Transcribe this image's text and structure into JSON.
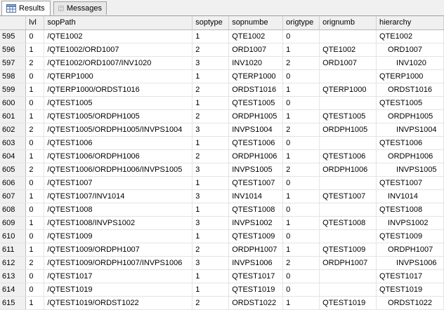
{
  "tabs": {
    "results_label": "Results",
    "messages_label": "Messages"
  },
  "columns": [
    "lvl",
    "sopPath",
    "soptype",
    "sopnumbe",
    "origtype",
    "orignumb",
    "hierarchy"
  ],
  "rows": [
    {
      "n": "595",
      "lvl": "0",
      "path": "/QTE1002",
      "soptype": "1",
      "sopnumbe": "QTE1002",
      "origtype": "0",
      "orignumb": "",
      "hierarchy": "QTE1002",
      "indent": 0
    },
    {
      "n": "596",
      "lvl": "1",
      "path": "/QTE1002/ORD1007",
      "soptype": "2",
      "sopnumbe": "ORD1007",
      "origtype": "1",
      "orignumb": "QTE1002",
      "hierarchy": "ORD1007",
      "indent": 1
    },
    {
      "n": "597",
      "lvl": "2",
      "path": "/QTE1002/ORD1007/INV1020",
      "soptype": "3",
      "sopnumbe": "INV1020",
      "origtype": "2",
      "orignumb": "ORD1007",
      "hierarchy": "INV1020",
      "indent": 2
    },
    {
      "n": "598",
      "lvl": "0",
      "path": "/QTERP1000",
      "soptype": "1",
      "sopnumbe": "QTERP1000",
      "origtype": "0",
      "orignumb": "",
      "hierarchy": "QTERP1000",
      "indent": 0
    },
    {
      "n": "599",
      "lvl": "1",
      "path": "/QTERP1000/ORDST1016",
      "soptype": "2",
      "sopnumbe": "ORDST1016",
      "origtype": "1",
      "orignumb": "QTERP1000",
      "hierarchy": "ORDST1016",
      "indent": 1
    },
    {
      "n": "600",
      "lvl": "0",
      "path": "/QTEST1005",
      "soptype": "1",
      "sopnumbe": "QTEST1005",
      "origtype": "0",
      "orignumb": "",
      "hierarchy": "QTEST1005",
      "indent": 0
    },
    {
      "n": "601",
      "lvl": "1",
      "path": "/QTEST1005/ORDPH1005",
      "soptype": "2",
      "sopnumbe": "ORDPH1005",
      "origtype": "1",
      "orignumb": "QTEST1005",
      "hierarchy": "ORDPH1005",
      "indent": 1
    },
    {
      "n": "602",
      "lvl": "2",
      "path": "/QTEST1005/ORDPH1005/INVPS1004",
      "soptype": "3",
      "sopnumbe": "INVPS1004",
      "origtype": "2",
      "orignumb": "ORDPH1005",
      "hierarchy": "INVPS1004",
      "indent": 2
    },
    {
      "n": "603",
      "lvl": "0",
      "path": "/QTEST1006",
      "soptype": "1",
      "sopnumbe": "QTEST1006",
      "origtype": "0",
      "orignumb": "",
      "hierarchy": "QTEST1006",
      "indent": 0
    },
    {
      "n": "604",
      "lvl": "1",
      "path": "/QTEST1006/ORDPH1006",
      "soptype": "2",
      "sopnumbe": "ORDPH1006",
      "origtype": "1",
      "orignumb": "QTEST1006",
      "hierarchy": "ORDPH1006",
      "indent": 1
    },
    {
      "n": "605",
      "lvl": "2",
      "path": "/QTEST1006/ORDPH1006/INVPS1005",
      "soptype": "3",
      "sopnumbe": "INVPS1005",
      "origtype": "2",
      "orignumb": "ORDPH1006",
      "hierarchy": "INVPS1005",
      "indent": 2
    },
    {
      "n": "606",
      "lvl": "0",
      "path": "/QTEST1007",
      "soptype": "1",
      "sopnumbe": "QTEST1007",
      "origtype": "0",
      "orignumb": "",
      "hierarchy": "QTEST1007",
      "indent": 0
    },
    {
      "n": "607",
      "lvl": "1",
      "path": "/QTEST1007/INV1014",
      "soptype": "3",
      "sopnumbe": "INV1014",
      "origtype": "1",
      "orignumb": "QTEST1007",
      "hierarchy": "INV1014",
      "indent": 1
    },
    {
      "n": "608",
      "lvl": "0",
      "path": "/QTEST1008",
      "soptype": "1",
      "sopnumbe": "QTEST1008",
      "origtype": "0",
      "orignumb": "",
      "hierarchy": "QTEST1008",
      "indent": 0
    },
    {
      "n": "609",
      "lvl": "1",
      "path": "/QTEST1008/INVPS1002",
      "soptype": "3",
      "sopnumbe": "INVPS1002",
      "origtype": "1",
      "orignumb": "QTEST1008",
      "hierarchy": "INVPS1002",
      "indent": 1
    },
    {
      "n": "610",
      "lvl": "0",
      "path": "/QTEST1009",
      "soptype": "1",
      "sopnumbe": "QTEST1009",
      "origtype": "0",
      "orignumb": "",
      "hierarchy": "QTEST1009",
      "indent": 0
    },
    {
      "n": "611",
      "lvl": "1",
      "path": "/QTEST1009/ORDPH1007",
      "soptype": "2",
      "sopnumbe": "ORDPH1007",
      "origtype": "1",
      "orignumb": "QTEST1009",
      "hierarchy": "ORDPH1007",
      "indent": 1
    },
    {
      "n": "612",
      "lvl": "2",
      "path": "/QTEST1009/ORDPH1007/INVPS1006",
      "soptype": "3",
      "sopnumbe": "INVPS1006",
      "origtype": "2",
      "orignumb": "ORDPH1007",
      "hierarchy": "INVPS1006",
      "indent": 2
    },
    {
      "n": "613",
      "lvl": "0",
      "path": "/QTEST1017",
      "soptype": "1",
      "sopnumbe": "QTEST1017",
      "origtype": "0",
      "orignumb": "",
      "hierarchy": "QTEST1017",
      "indent": 0
    },
    {
      "n": "614",
      "lvl": "0",
      "path": "/QTEST1019",
      "soptype": "1",
      "sopnumbe": "QTEST1019",
      "origtype": "0",
      "orignumb": "",
      "hierarchy": "QTEST1019",
      "indent": 0
    },
    {
      "n": "615",
      "lvl": "1",
      "path": "/QTEST1019/ORDST1022",
      "soptype": "2",
      "sopnumbe": "ORDST1022",
      "origtype": "1",
      "orignumb": "QTEST1019",
      "hierarchy": "ORDST1022",
      "indent": 1
    }
  ]
}
